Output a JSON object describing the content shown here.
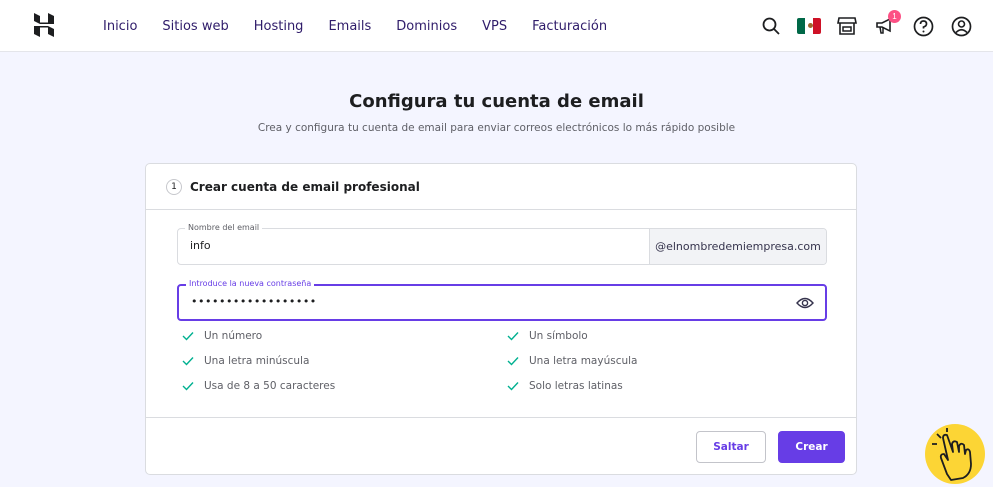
{
  "nav": {
    "items": [
      "Inicio",
      "Sitios web",
      "Hosting",
      "Emails",
      "Dominios",
      "VPS",
      "Facturación"
    ],
    "notification_count": "1",
    "icons": [
      "search-icon",
      "mexico-flag-icon",
      "store-icon",
      "megaphone-icon",
      "help-icon",
      "account-icon"
    ]
  },
  "header": {
    "title": "Configura tu cuenta de email",
    "subtitle": "Crea y configura tu cuenta de email para enviar correos electrónicos lo más rápido posible"
  },
  "card": {
    "step": "1",
    "title": "Crear cuenta de email profesional",
    "email_field": {
      "label": "Nombre del email",
      "value": "info",
      "domain_suffix": "@elnombredemiempresa.com"
    },
    "password_field": {
      "label": "Introduce la nueva contraseña",
      "value": "••••••••••••••••••"
    },
    "requirements": [
      "Un número",
      "Un símbolo",
      "Una letra minúscula",
      "Una letra mayúscula",
      "Usa de 8 a 50 caracteres",
      "Solo letras latinas"
    ],
    "buttons": {
      "skip": "Saltar",
      "create": "Crear"
    }
  },
  "colors": {
    "accent": "#673de6",
    "check": "#00b090",
    "badge": "#fc5185",
    "helper": "#fcd535"
  }
}
